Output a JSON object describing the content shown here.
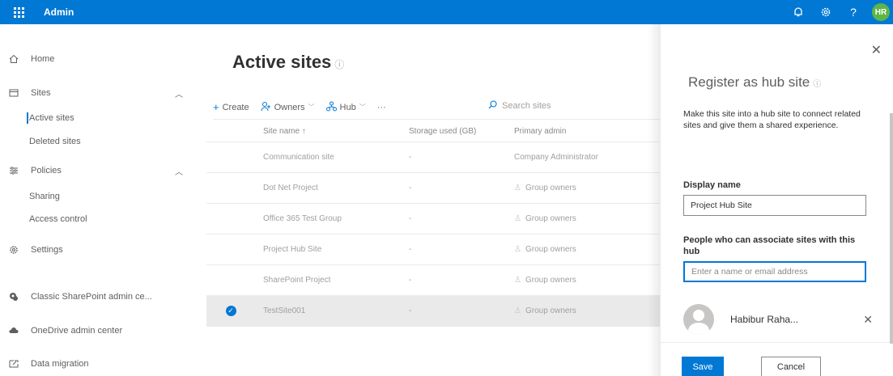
{
  "topbar": {
    "app_title": "Admin",
    "icons": [
      "notifications-icon",
      "settings-icon",
      "help-icon"
    ],
    "avatar_initials": "HR"
  },
  "sidebar": {
    "items": [
      {
        "label": "Home",
        "icon": "home-icon"
      },
      {
        "label": "Sites",
        "icon": "sites-icon",
        "expanded": true
      },
      {
        "label": "Active sites",
        "sub": true,
        "active": true
      },
      {
        "label": "Deleted sites",
        "sub": true
      },
      {
        "label": "Policies",
        "icon": "policies-icon",
        "expanded": true
      },
      {
        "label": "Sharing",
        "sub": true
      },
      {
        "label": "Access control",
        "sub": true
      },
      {
        "label": "Settings",
        "icon": "gear-icon"
      },
      {
        "label": "Classic SharePoint admin ce...",
        "icon": "sharepoint-icon"
      },
      {
        "label": "OneDrive admin center",
        "icon": "cloud-icon"
      },
      {
        "label": "Data migration",
        "icon": "migration-icon"
      }
    ]
  },
  "main": {
    "title": "Active sites",
    "toolbar": {
      "create": "Create",
      "owners": "Owners",
      "hub": "Hub",
      "more": "···",
      "search_placeholder": "Search sites"
    },
    "columns": {
      "name": "Site name ↑",
      "storage": "Storage used (GB)",
      "admin": "Primary admin"
    },
    "rows": [
      {
        "name": "Communication site",
        "storage": "-",
        "admin": "Company Administrator",
        "group": false,
        "selected": false
      },
      {
        "name": "Dot Net Project",
        "storage": "-",
        "admin": "Group owners",
        "group": true,
        "selected": false
      },
      {
        "name": "Office 365 Test Group",
        "storage": "-",
        "admin": "Group owners",
        "group": true,
        "selected": false
      },
      {
        "name": "Project Hub Site",
        "storage": "-",
        "admin": "Group owners",
        "group": true,
        "selected": false
      },
      {
        "name": "SharePoint Project",
        "storage": "-",
        "admin": "Group owners",
        "group": true,
        "selected": false
      },
      {
        "name": "TestSite001",
        "storage": "-",
        "admin": "Group owners",
        "group": true,
        "selected": true
      }
    ]
  },
  "panel": {
    "title": "Register as hub site",
    "description": "Make this site into a hub site to connect related sites and give them a shared experience.",
    "display_name_label": "Display name",
    "display_name_value": "Project Hub Site",
    "people_label": "People who can associate sites with this hub",
    "people_placeholder": "Enter a name or email address",
    "person_name": "Habibur Raha...",
    "save_label": "Save",
    "cancel_label": "Cancel"
  },
  "colors": {
    "accent": "#0078d4",
    "avatar": "#5db548"
  }
}
